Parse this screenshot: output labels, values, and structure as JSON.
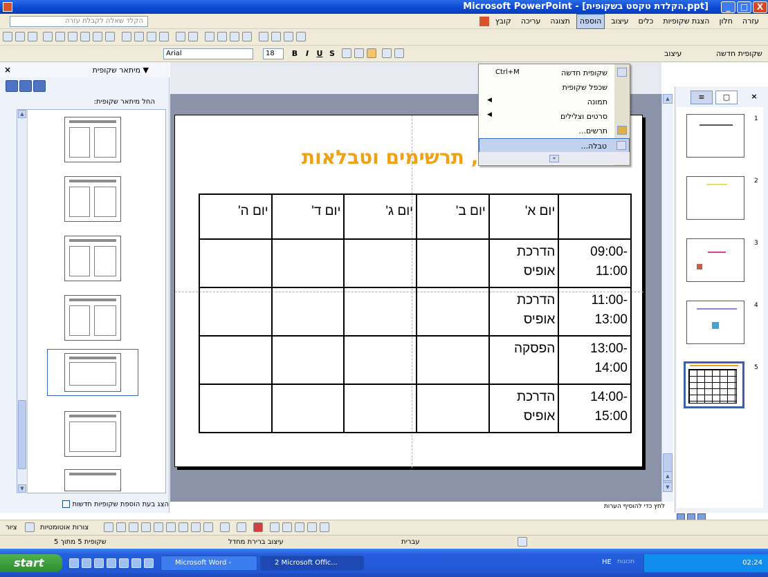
{
  "window": {
    "title": "Microsoft PowerPoint - [הקלדת טקסט בשקופית.ppt]",
    "min_label": "_",
    "max_label": "□",
    "close_label": "X"
  },
  "menubar": {
    "help_placeholder": "הקלד שאלה לקבלת עזרה",
    "items": [
      "קובץ",
      "עריכה",
      "תצוגה",
      "הוספה",
      "עיצוב",
      "כלים",
      "הצגת שקופיות",
      "חלון",
      "עזרה"
    ],
    "active_index": 3
  },
  "toolbar": {
    "font_name": "Arial",
    "font_size": "18",
    "bold": "B",
    "italic": "I",
    "underline": "U",
    "shadow": "S",
    "new_slide": "שקופית חדשה",
    "design": "עיצוב"
  },
  "dropdown": {
    "items": [
      {
        "label": "שקופית חדשה",
        "shortcut": "Ctrl+M",
        "submenu": false,
        "highlighted": false
      },
      {
        "label": "שכפל שקופית",
        "shortcut": "",
        "submenu": false,
        "highlighted": false
      },
      {
        "label": "תמונה",
        "shortcut": "",
        "submenu": true,
        "highlighted": false
      },
      {
        "label": "סרטים וצלילים",
        "shortcut": "",
        "submenu": true,
        "highlighted": false
      },
      {
        "label": "תרשים...",
        "shortcut": "",
        "submenu": false,
        "highlighted": false
      },
      {
        "label": "טבלה...",
        "shortcut": "",
        "submenu": false,
        "highlighted": true
      }
    ],
    "expand_label": "»"
  },
  "left_pane": {
    "title": "▼ מיתאר שקופית",
    "close": "×",
    "section_label": "החל מיתאר שקופית:",
    "checkbox_label": "הצג בעת הוספת שקופיות חדשות",
    "selected_index": 4
  },
  "slide": {
    "title": "הוספת דיאגרמות, תרשימים וטבלאות",
    "table": {
      "headers": [
        "",
        "יום א'",
        "יום ב'",
        "יום ג'",
        "יום ד'",
        "יום ה'"
      ],
      "rows": [
        [
          "09:00-11:00",
          "הדרכת אופיס",
          "",
          "",
          "",
          ""
        ],
        [
          "11:00-13:00",
          "הדרכת אופיס",
          "",
          "",
          "",
          ""
        ],
        [
          "13:00-14:00",
          "הפסקה",
          "",
          "",
          "",
          ""
        ],
        [
          "14:00-15:00",
          "הדרכת אופיס",
          "",
          "",
          "",
          ""
        ]
      ]
    }
  },
  "right_pane": {
    "tab_outline": "≡",
    "tab_slides": "▢",
    "close": "×",
    "slide_numbers": [
      "1",
      "2",
      "3",
      "4",
      "5"
    ],
    "selected_slide": 5
  },
  "notes_hint": "לחץ כדי להוסיף הערות",
  "drawbar": {
    "draw_label": "ציור",
    "autoshapes_label": "צורות אוטומטיות"
  },
  "statusbar": {
    "slide_position": "שקופית 5 מתוך 5",
    "design_template": "עיצוב ברירת מחדל",
    "language": "עברית"
  },
  "taskbar": {
    "start": "start",
    "task1": "Microsoft Word -",
    "task2": "2 Microsoft Offic...",
    "lang": "HE",
    "lang_hint": "תכונות",
    "clock": "02:24"
  },
  "colors": {
    "title_orange": "#f0a014",
    "xp_blue": "#0a48d4",
    "highlight": "#c1d2ee"
  }
}
